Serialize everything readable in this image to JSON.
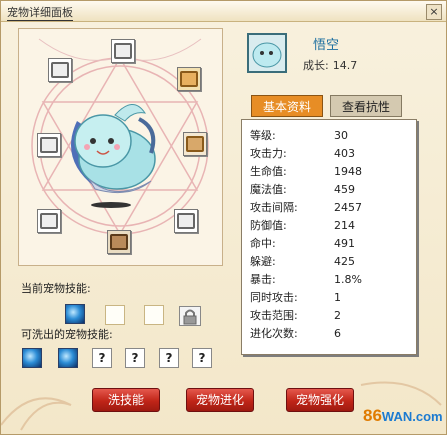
{
  "window": {
    "title": "宠物详细面板",
    "close_label": "×"
  },
  "pet": {
    "name": "悟空",
    "growth_label": "成长:",
    "growth_value": "14.7"
  },
  "tabs": [
    {
      "label": "基本资料",
      "active": true
    },
    {
      "label": "查看抗性",
      "active": false
    }
  ],
  "stats": [
    {
      "label": "等级:",
      "value": "30"
    },
    {
      "label": "攻击力:",
      "value": "403"
    },
    {
      "label": "生命值:",
      "value": "1948"
    },
    {
      "label": "魔法值:",
      "value": "459"
    },
    {
      "label": "攻击间隔:",
      "value": "2457"
    },
    {
      "label": "防御值:",
      "value": "214"
    },
    {
      "label": "命中:",
      "value": "491"
    },
    {
      "label": "躲避:",
      "value": "425"
    },
    {
      "label": "暴击:",
      "value": "1.8%"
    },
    {
      "label": "同时攻击:",
      "value": "1"
    },
    {
      "label": "攻击范围:",
      "value": "2"
    },
    {
      "label": "进化次数:",
      "value": "6"
    }
  ],
  "skills": {
    "current_label": "当前宠物技能:",
    "washable_label": "可洗出的宠物技能:",
    "unknown_symbol": "?"
  },
  "buttons": {
    "wash": "洗技能",
    "evolve": "宠物进化",
    "strengthen": "宠物强化"
  },
  "logo": {
    "number": "86",
    "text": "WAN.com"
  },
  "colors": {
    "tab_active": "#e78d25",
    "button_red": "#c02518",
    "name_blue": "#1e6fa0"
  }
}
